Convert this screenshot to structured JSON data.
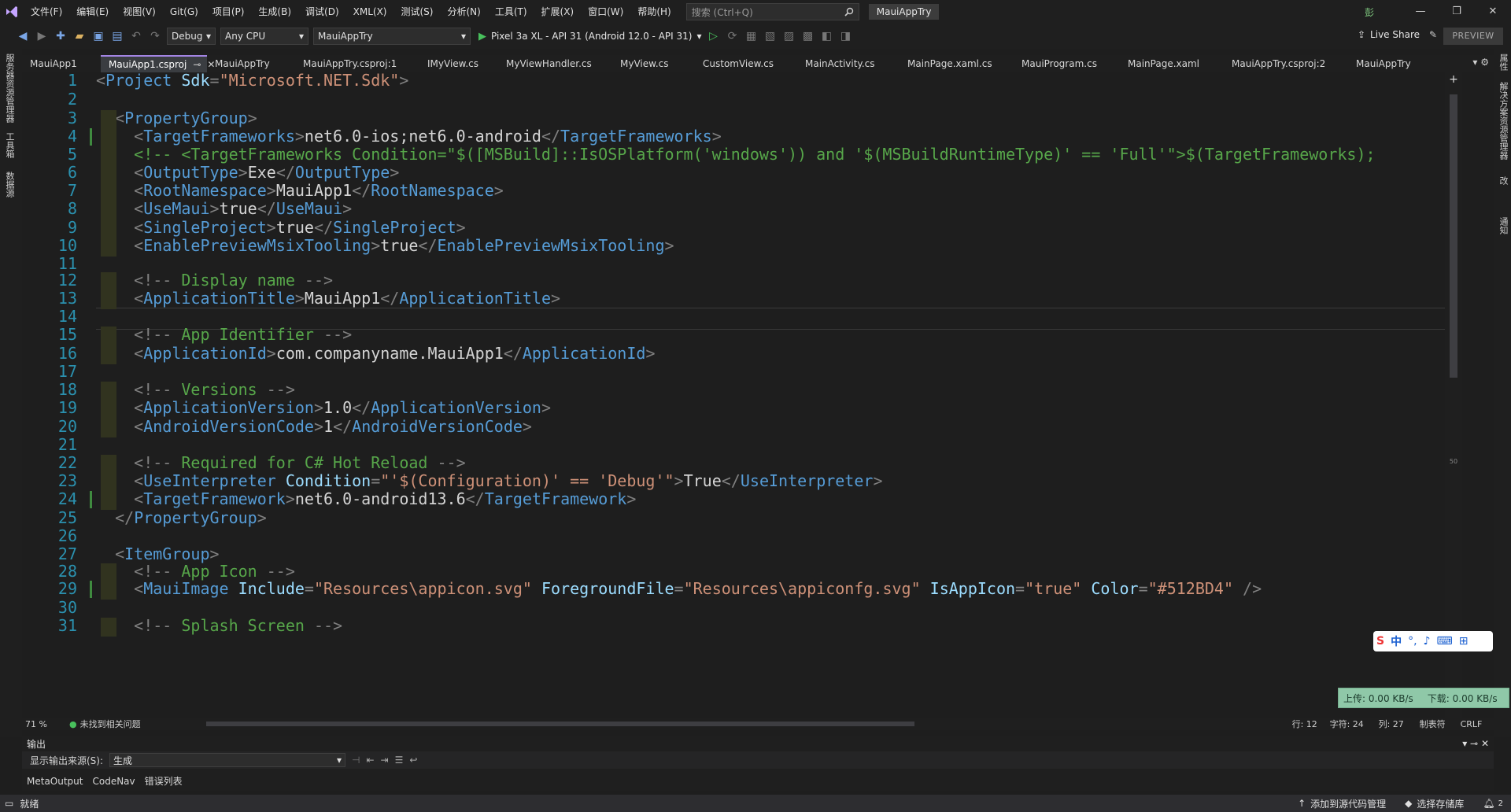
{
  "menu": [
    "文件(F)",
    "编辑(E)",
    "视图(V)",
    "Git(G)",
    "项目(P)",
    "生成(B)",
    "调试(D)",
    "XML(X)",
    "测试(S)",
    "分析(N)",
    "工具(T)",
    "扩展(X)",
    "窗口(W)",
    "帮助(H)"
  ],
  "search": {
    "placeholder": "搜索 (Ctrl+Q)"
  },
  "title_chip": "MauiAppTry",
  "user_badge": "彭",
  "toolbar": {
    "config": "Debug",
    "platform": "Any CPU",
    "startup_project": "MauiAppTry",
    "run_target": "Pixel 3a XL - API 31 (Android 12.0 - API 31)",
    "live_share": "Live Share",
    "preview": "PREVIEW"
  },
  "left_tabs": [
    "服务器资源管理器",
    "工具箱",
    "数据源"
  ],
  "right_tabs": [
    "属性",
    "解决方案资源管理器",
    "Git 更改",
    "通知"
  ],
  "tabs": [
    {
      "label": "MauiApp1",
      "active": false
    },
    {
      "label": "MauiApp1.csproj",
      "active": true
    },
    {
      "label": "MauiAppTry",
      "active": false
    },
    {
      "label": "MauiAppTry.csproj:1",
      "active": false
    },
    {
      "label": "IMyView.cs",
      "active": false
    },
    {
      "label": "MyViewHandler.cs",
      "active": false
    },
    {
      "label": "MyView.cs",
      "active": false
    },
    {
      "label": "CustomView.cs",
      "active": false
    },
    {
      "label": "MainActivity.cs",
      "active": false
    },
    {
      "label": "MainPage.xaml.cs",
      "active": false
    },
    {
      "label": "MauiProgram.cs",
      "active": false
    },
    {
      "label": "MainPage.xaml",
      "active": false
    },
    {
      "label": "MauiAppTry.csproj:2",
      "active": false
    },
    {
      "label": "MauiAppTry",
      "active": false
    }
  ],
  "code_lines": [
    {
      "n": "1",
      "tokens": [
        [
          "d",
          "<"
        ],
        [
          "t",
          "Project"
        ],
        [
          "a",
          " Sdk"
        ],
        [
          "d",
          "="
        ],
        [
          "s",
          "\"Microsoft.NET.Sdk\""
        ],
        [
          "d",
          ">"
        ]
      ]
    },
    {
      "n": "2",
      "tokens": []
    },
    {
      "n": "3",
      "tokens": [
        [
          "x",
          "  "
        ],
        [
          "d",
          "<"
        ],
        [
          "t",
          "PropertyGroup"
        ],
        [
          "d",
          ">"
        ]
      ]
    },
    {
      "n": "4",
      "tokens": [
        [
          "x",
          "    "
        ],
        [
          "d",
          "<"
        ],
        [
          "t",
          "TargetFrameworks"
        ],
        [
          "d",
          ">"
        ],
        [
          "x",
          "net6.0-ios;net6.0-android"
        ],
        [
          "d",
          "</"
        ],
        [
          "t",
          "TargetFrameworks"
        ],
        [
          "d",
          ">"
        ]
      ]
    },
    {
      "n": "5",
      "tokens": [
        [
          "x",
          "    "
        ],
        [
          "c",
          "<!-- <TargetFrameworks Condition=\"$([MSBuild]::IsOSPlatform('windows')) and '$(MSBuildRuntimeType)' == 'Full'\">$(TargetFrameworks);"
        ]
      ]
    },
    {
      "n": "6",
      "tokens": [
        [
          "x",
          "    "
        ],
        [
          "d",
          "<"
        ],
        [
          "t",
          "OutputType"
        ],
        [
          "d",
          ">"
        ],
        [
          "x",
          "Exe"
        ],
        [
          "d",
          "</"
        ],
        [
          "t",
          "OutputType"
        ],
        [
          "d",
          ">"
        ]
      ]
    },
    {
      "n": "7",
      "tokens": [
        [
          "x",
          "    "
        ],
        [
          "d",
          "<"
        ],
        [
          "t",
          "RootNamespace"
        ],
        [
          "d",
          ">"
        ],
        [
          "x",
          "MauiApp1"
        ],
        [
          "d",
          "</"
        ],
        [
          "t",
          "RootNamespace"
        ],
        [
          "d",
          ">"
        ]
      ]
    },
    {
      "n": "8",
      "tokens": [
        [
          "x",
          "    "
        ],
        [
          "d",
          "<"
        ],
        [
          "t",
          "UseMaui"
        ],
        [
          "d",
          ">"
        ],
        [
          "x",
          "true"
        ],
        [
          "d",
          "</"
        ],
        [
          "t",
          "UseMaui"
        ],
        [
          "d",
          ">"
        ]
      ]
    },
    {
      "n": "9",
      "tokens": [
        [
          "x",
          "    "
        ],
        [
          "d",
          "<"
        ],
        [
          "t",
          "SingleProject"
        ],
        [
          "d",
          ">"
        ],
        [
          "x",
          "true"
        ],
        [
          "d",
          "</"
        ],
        [
          "t",
          "SingleProject"
        ],
        [
          "d",
          ">"
        ]
      ]
    },
    {
      "n": "10",
      "tokens": [
        [
          "x",
          "    "
        ],
        [
          "d",
          "<"
        ],
        [
          "t",
          "EnablePreviewMsixTooling"
        ],
        [
          "d",
          ">"
        ],
        [
          "x",
          "true"
        ],
        [
          "d",
          "</"
        ],
        [
          "t",
          "EnablePreviewMsixTooling"
        ],
        [
          "d",
          ">"
        ]
      ]
    },
    {
      "n": "11",
      "tokens": []
    },
    {
      "n": "12",
      "tokens": [
        [
          "x",
          "    "
        ],
        [
          "d",
          "<!--"
        ],
        [
          "c",
          " Display name "
        ],
        [
          "d",
          "-->"
        ]
      ]
    },
    {
      "n": "13",
      "tokens": [
        [
          "x",
          "    "
        ],
        [
          "d",
          "<"
        ],
        [
          "t",
          "ApplicationTitle"
        ],
        [
          "d",
          ">"
        ],
        [
          "x",
          "MauiApp1"
        ],
        [
          "d",
          "</"
        ],
        [
          "t",
          "ApplicationTitle"
        ],
        [
          "d",
          ">"
        ]
      ]
    },
    {
      "n": "14",
      "tokens": []
    },
    {
      "n": "15",
      "tokens": [
        [
          "x",
          "    "
        ],
        [
          "d",
          "<!--"
        ],
        [
          "c",
          " App Identifier "
        ],
        [
          "d",
          "-->"
        ]
      ]
    },
    {
      "n": "16",
      "tokens": [
        [
          "x",
          "    "
        ],
        [
          "d",
          "<"
        ],
        [
          "t",
          "ApplicationId"
        ],
        [
          "d",
          ">"
        ],
        [
          "x",
          "com.companyname.MauiApp1"
        ],
        [
          "d",
          "</"
        ],
        [
          "t",
          "ApplicationId"
        ],
        [
          "d",
          ">"
        ]
      ]
    },
    {
      "n": "17",
      "tokens": []
    },
    {
      "n": "18",
      "tokens": [
        [
          "x",
          "    "
        ],
        [
          "d",
          "<!--"
        ],
        [
          "c",
          " Versions "
        ],
        [
          "d",
          "-->"
        ]
      ]
    },
    {
      "n": "19",
      "tokens": [
        [
          "x",
          "    "
        ],
        [
          "d",
          "<"
        ],
        [
          "t",
          "ApplicationVersion"
        ],
        [
          "d",
          ">"
        ],
        [
          "x",
          "1.0"
        ],
        [
          "d",
          "</"
        ],
        [
          "t",
          "ApplicationVersion"
        ],
        [
          "d",
          ">"
        ]
      ]
    },
    {
      "n": "20",
      "tokens": [
        [
          "x",
          "    "
        ],
        [
          "d",
          "<"
        ],
        [
          "t",
          "AndroidVersionCode"
        ],
        [
          "d",
          ">"
        ],
        [
          "x",
          "1"
        ],
        [
          "d",
          "</"
        ],
        [
          "t",
          "AndroidVersionCode"
        ],
        [
          "d",
          ">"
        ]
      ]
    },
    {
      "n": "21",
      "tokens": []
    },
    {
      "n": "22",
      "tokens": [
        [
          "x",
          "    "
        ],
        [
          "d",
          "<!--"
        ],
        [
          "c",
          " Required for C# Hot Reload "
        ],
        [
          "d",
          "-->"
        ]
      ]
    },
    {
      "n": "23",
      "tokens": [
        [
          "x",
          "    "
        ],
        [
          "d",
          "<"
        ],
        [
          "t",
          "UseInterpreter"
        ],
        [
          "a",
          " Condition"
        ],
        [
          "d",
          "="
        ],
        [
          "s",
          "\"'$(Configuration)' == 'Debug'\""
        ],
        [
          "d",
          ">"
        ],
        [
          "x",
          "True"
        ],
        [
          "d",
          "</"
        ],
        [
          "t",
          "UseInterpreter"
        ],
        [
          "d",
          ">"
        ]
      ]
    },
    {
      "n": "24",
      "tokens": [
        [
          "x",
          "    "
        ],
        [
          "d",
          "<"
        ],
        [
          "t",
          "TargetFramework"
        ],
        [
          "d",
          ">"
        ],
        [
          "x",
          "net6.0-android13.6"
        ],
        [
          "d",
          "</"
        ],
        [
          "t",
          "TargetFramework"
        ],
        [
          "d",
          ">"
        ]
      ]
    },
    {
      "n": "25",
      "tokens": [
        [
          "x",
          "  "
        ],
        [
          "d",
          "</"
        ],
        [
          "t",
          "PropertyGroup"
        ],
        [
          "d",
          ">"
        ]
      ]
    },
    {
      "n": "26",
      "tokens": []
    },
    {
      "n": "27",
      "tokens": [
        [
          "x",
          "  "
        ],
        [
          "d",
          "<"
        ],
        [
          "t",
          "ItemGroup"
        ],
        [
          "d",
          ">"
        ]
      ]
    },
    {
      "n": "28",
      "tokens": [
        [
          "x",
          "    "
        ],
        [
          "d",
          "<!--"
        ],
        [
          "c",
          " App Icon "
        ],
        [
          "d",
          "-->"
        ]
      ]
    },
    {
      "n": "29",
      "tokens": [
        [
          "x",
          "    "
        ],
        [
          "d",
          "<"
        ],
        [
          "t",
          "MauiImage"
        ],
        [
          "a",
          " Include"
        ],
        [
          "d",
          "="
        ],
        [
          "s",
          "\"Resources\\appicon.svg\""
        ],
        [
          "a",
          " ForegroundFile"
        ],
        [
          "d",
          "="
        ],
        [
          "s",
          "\"Resources\\appiconfg.svg\""
        ],
        [
          "a",
          " IsAppIcon"
        ],
        [
          "d",
          "="
        ],
        [
          "s",
          "\"true\""
        ],
        [
          "a",
          " Color"
        ],
        [
          "d",
          "="
        ],
        [
          "s",
          "\"#512BD4\""
        ],
        [
          "d",
          " />"
        ]
      ]
    },
    {
      "n": "30",
      "tokens": []
    },
    {
      "n": "31",
      "tokens": [
        [
          "x",
          "    "
        ],
        [
          "d",
          "<!--"
        ],
        [
          "c",
          " Splash Screen "
        ],
        [
          "d",
          "-->"
        ]
      ]
    }
  ],
  "editor_status": {
    "zoom": "71 %",
    "issues": "未找到相关问题",
    "line": "行: 12",
    "char": "字符: 24",
    "col": "列: 27",
    "tabs_mode": "制表符",
    "eol": "CRLF"
  },
  "minimap_marker": "50",
  "output": {
    "title": "输出",
    "source_label": "显示输出来源(S):",
    "source_value": "生成"
  },
  "bottom_tabs": [
    "MetaOutput",
    "CodeNav",
    "错误列表"
  ],
  "statusbar": {
    "ready": "就绪",
    "add_source": "添加到源代码管理",
    "select_repo": "选择存储库",
    "notifications": "2"
  },
  "net_speed": {
    "up": "上传: 0.00 KB/s",
    "down": "下载: 0.00 KB/s"
  },
  "ime": {
    "mode": "中"
  },
  "colors": {
    "accent": "#a385e4",
    "tag": "#569cd6",
    "attr": "#9cdcfe",
    "string": "#ce9178",
    "comment": "#57a64a",
    "line_number": "#2b91af"
  }
}
